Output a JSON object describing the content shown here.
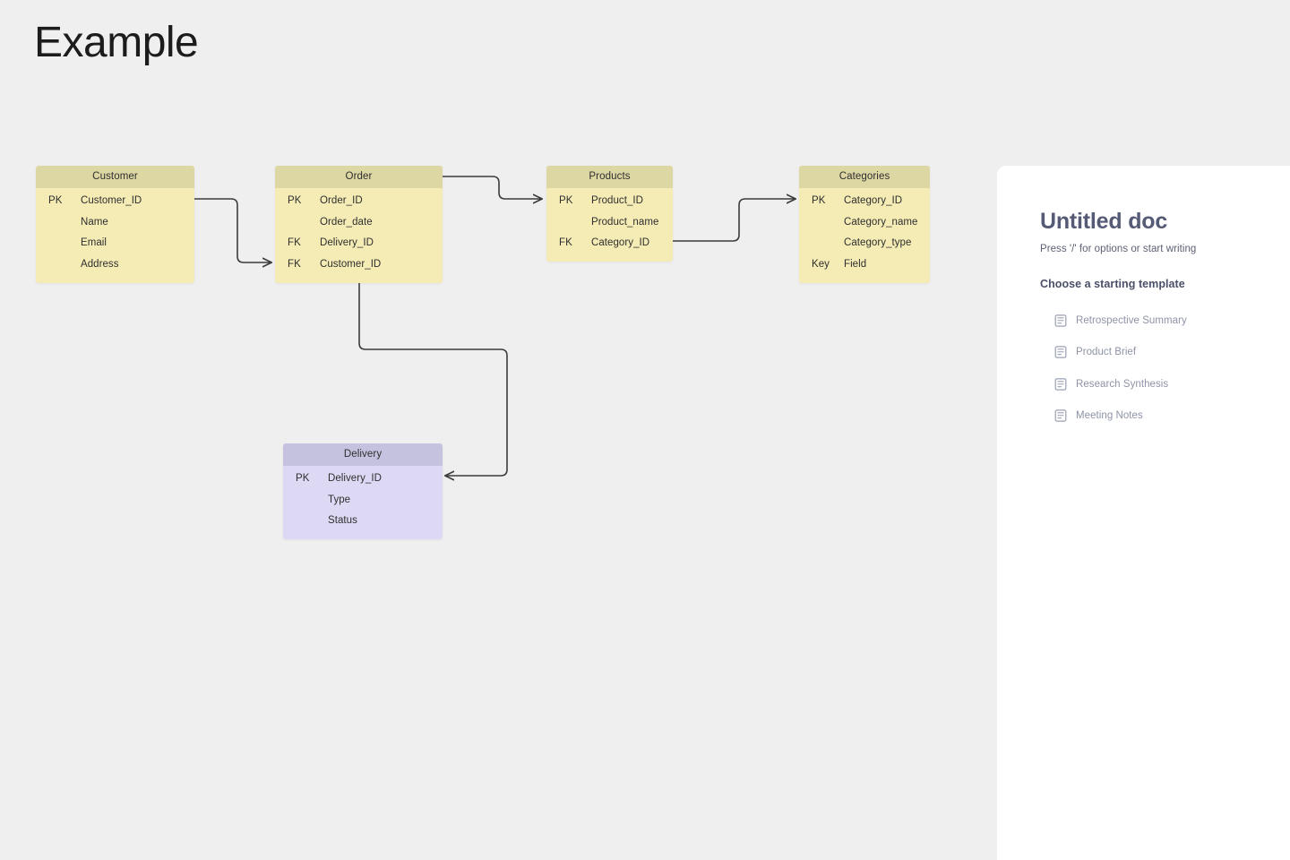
{
  "page": {
    "title": "Example",
    "background_color": "#efefef"
  },
  "diagram": {
    "type": "entity-relationship-diagram",
    "palette": {
      "yellow_header": "#ddd7a3",
      "yellow_body": "#f5ecb5",
      "purple_header": "#c5c2e0",
      "purple_body": "#ddd9f5",
      "connector": "#3b3b3b"
    },
    "tables": [
      {
        "id": "customer",
        "name": "Customer",
        "color": "yellow",
        "rows": [
          {
            "key": "PK",
            "field": "Customer_ID"
          },
          {
            "key": "",
            "field": "Name"
          },
          {
            "key": "",
            "field": "Email"
          },
          {
            "key": "",
            "field": "Address"
          }
        ]
      },
      {
        "id": "order",
        "name": "Order",
        "color": "yellow",
        "rows": [
          {
            "key": "PK",
            "field": "Order_ID"
          },
          {
            "key": "",
            "field": "Order_date"
          },
          {
            "key": "FK",
            "field": "Delivery_ID"
          },
          {
            "key": "FK",
            "field": "Customer_ID"
          }
        ]
      },
      {
        "id": "products",
        "name": "Products",
        "color": "yellow",
        "rows": [
          {
            "key": "PK",
            "field": "Product_ID"
          },
          {
            "key": "",
            "field": "Product_name"
          },
          {
            "key": "FK",
            "field": "Category_ID"
          }
        ]
      },
      {
        "id": "categories",
        "name": "Categories",
        "color": "yellow",
        "rows": [
          {
            "key": "PK",
            "field": "Category_ID"
          },
          {
            "key": "",
            "field": "Category_name"
          },
          {
            "key": "",
            "field": "Category_type"
          },
          {
            "key": "Key",
            "field": "Field"
          }
        ]
      },
      {
        "id": "delivery",
        "name": "Delivery",
        "color": "purple",
        "rows": [
          {
            "key": "PK",
            "field": "Delivery_ID"
          },
          {
            "key": "",
            "field": "Type"
          },
          {
            "key": "",
            "field": "Status"
          }
        ]
      }
    ],
    "relationships": [
      {
        "from": "customer",
        "to": "order",
        "to_field": "Customer_ID"
      },
      {
        "from": "order",
        "to": "products",
        "to_field": "Product_ID"
      },
      {
        "from": "products",
        "to": "categories",
        "to_field": "Category_ID"
      },
      {
        "from": "order",
        "to": "delivery",
        "to_field": "Delivery_ID"
      }
    ]
  },
  "doc_panel": {
    "title": "Untitled doc",
    "hint": "Press '/' for options or start writing",
    "section_label": "Choose a starting template",
    "templates": [
      {
        "icon": "document-icon",
        "label": "Retrospective Summary"
      },
      {
        "icon": "document-icon",
        "label": "Product Brief"
      },
      {
        "icon": "document-icon",
        "label": "Research Synthesis"
      },
      {
        "icon": "document-icon",
        "label": "Meeting Notes"
      }
    ]
  }
}
